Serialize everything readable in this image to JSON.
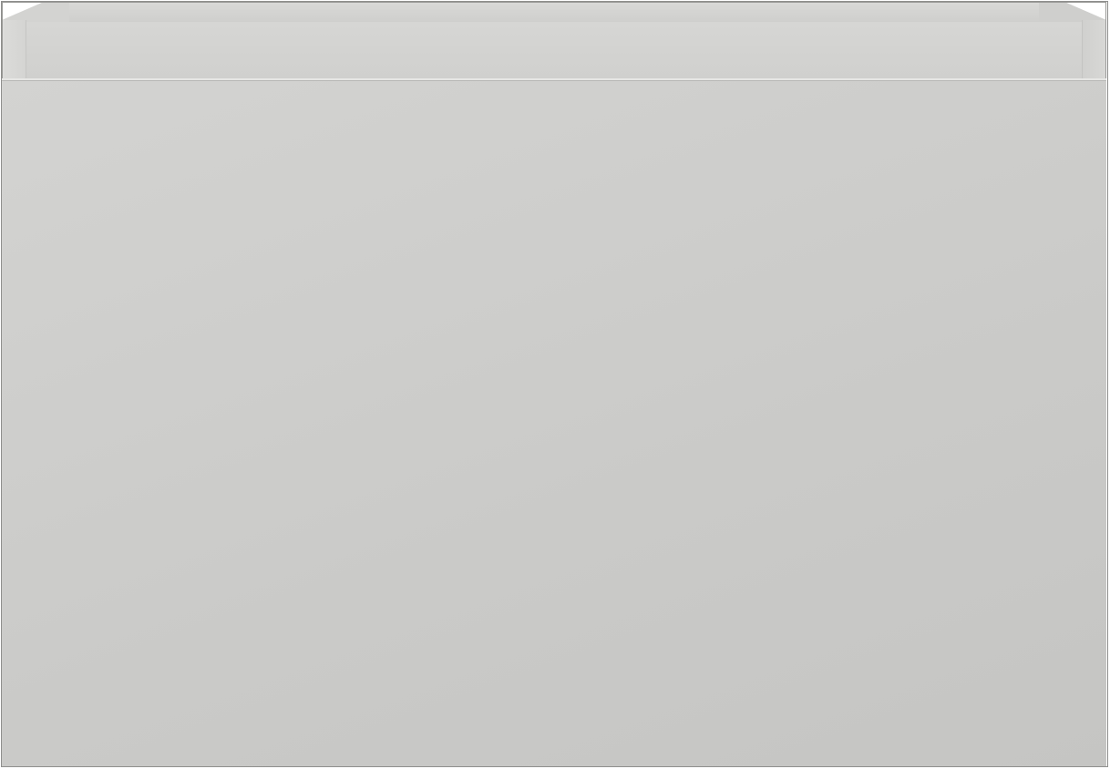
{
  "image": {
    "subject": "cabinet",
    "colors": {
      "panel": "#cbcbc9",
      "rim": "#d3d3d1",
      "outline": "#8f8f8d",
      "background": "#ffffff"
    }
  }
}
